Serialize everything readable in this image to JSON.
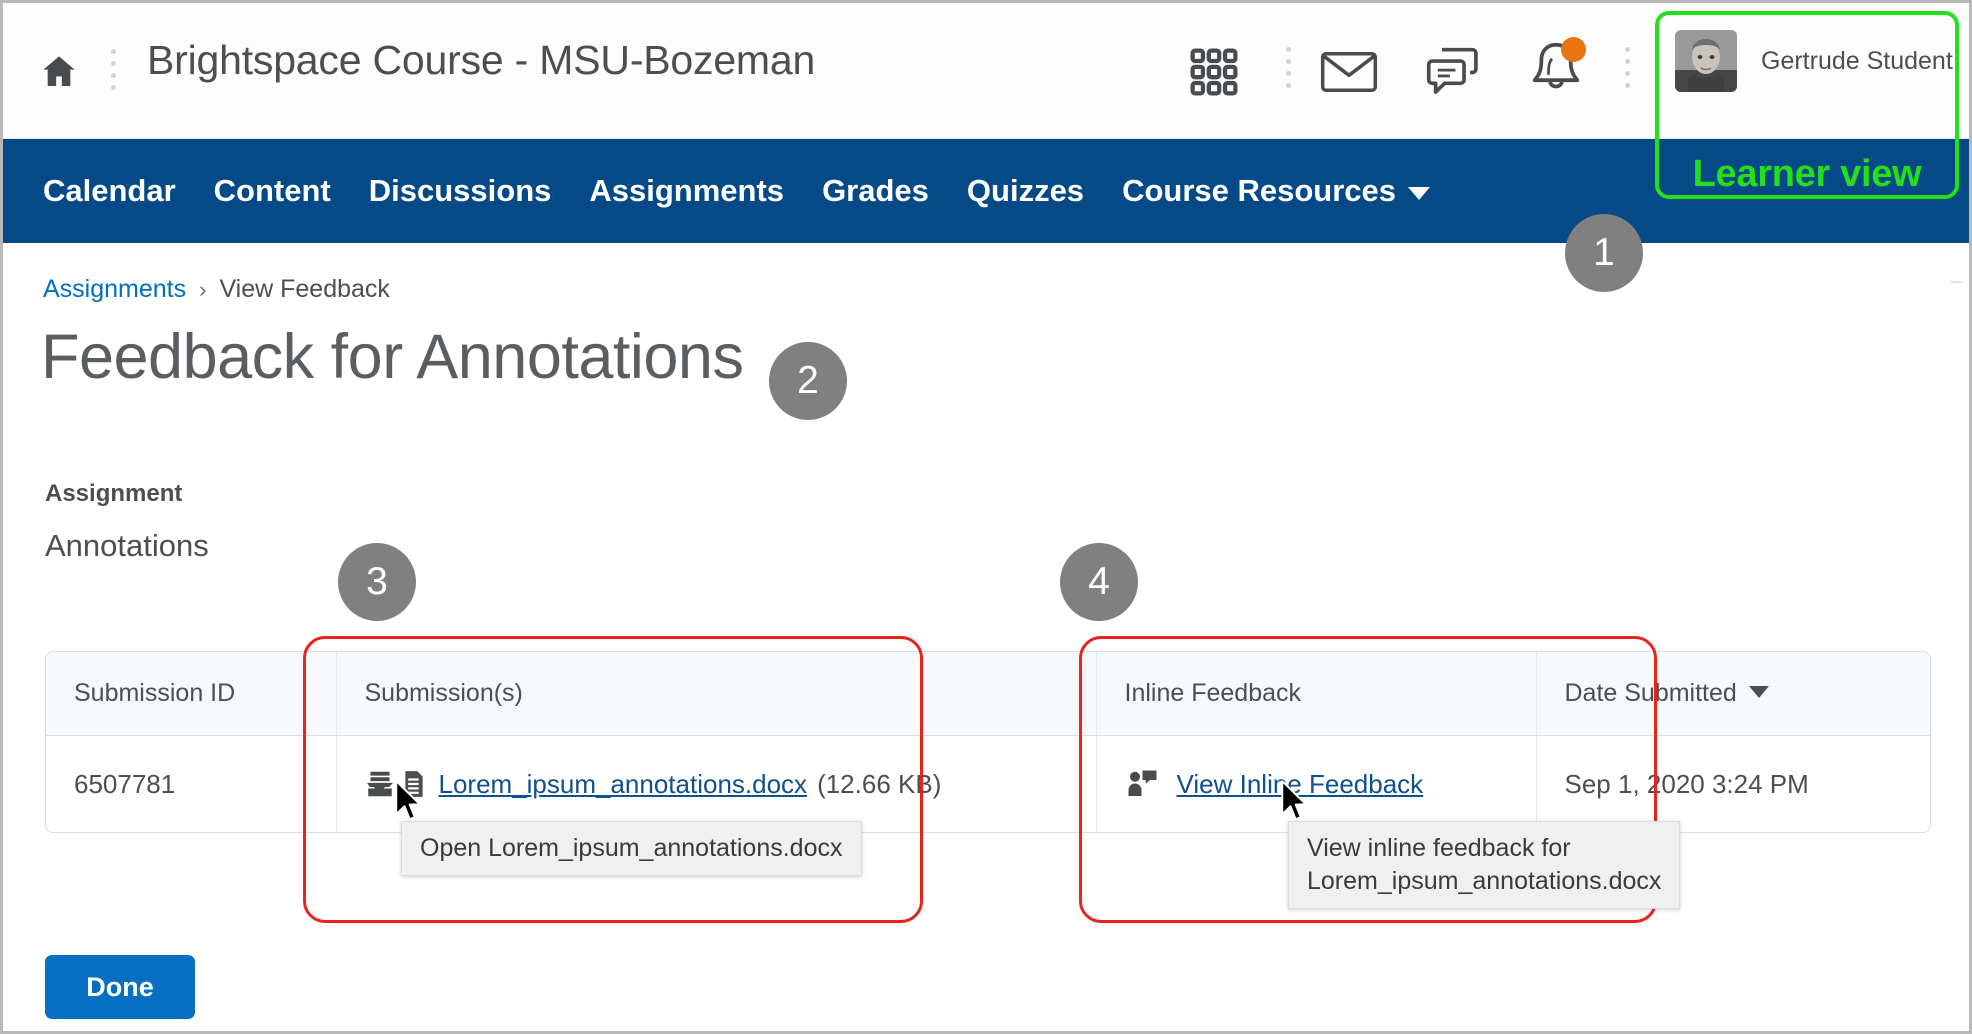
{
  "header": {
    "home_icon": "home-icon",
    "course_title": "Brightspace Course - MSU-Bozeman",
    "icons": [
      {
        "name": "waffle-menu-icon",
        "label": "Course selector"
      },
      {
        "name": "mail-icon",
        "label": "Email"
      },
      {
        "name": "chat-icon",
        "label": "Subscription alerts"
      },
      {
        "name": "bell-icon",
        "label": "Update alerts"
      }
    ],
    "notification_dot_color": "#e87511",
    "user_name": "Gertrude Student",
    "avatar_name": "user-avatar"
  },
  "annotations": {
    "green_box_label": "Learner view",
    "green_color": "#23e01b",
    "red_color": "#e8231c",
    "badges": [
      {
        "id": "1",
        "number": "1"
      },
      {
        "id": "2",
        "number": "2"
      },
      {
        "id": "3",
        "number": "3"
      },
      {
        "id": "4",
        "number": "4"
      }
    ]
  },
  "nav": {
    "brand_color": "#054a87",
    "items": [
      {
        "label": "Calendar",
        "has_caret": false
      },
      {
        "label": "Content",
        "has_caret": false
      },
      {
        "label": "Discussions",
        "has_caret": false
      },
      {
        "label": "Assignments",
        "has_caret": false
      },
      {
        "label": "Grades",
        "has_caret": false
      },
      {
        "label": "Quizzes",
        "has_caret": false
      },
      {
        "label": "Course Resources",
        "has_caret": true
      }
    ]
  },
  "breadcrumb": {
    "link_label": "Assignments",
    "separator": "›",
    "current_label": "View Feedback",
    "link_color": "#006fbf"
  },
  "page": {
    "title": "Feedback for Annotations",
    "assignment_label": "Assignment",
    "assignment_name": "Annotations"
  },
  "table": {
    "columns": [
      {
        "key": "submission_id",
        "label": "Submission ID",
        "sortable": false
      },
      {
        "key": "submissions",
        "label": "Submission(s)",
        "sortable": false
      },
      {
        "key": "inline_feedback",
        "label": "Inline Feedback",
        "sortable": false
      },
      {
        "key": "date_submitted",
        "label": "Date Submitted",
        "sortable": true,
        "sort_direction": "desc"
      }
    ],
    "rows": [
      {
        "submission_id": "6507781",
        "file_name": "Lorem_ipsum_annotations.docx",
        "file_size": "(12.66 KB)",
        "inline_feedback_link": "View Inline Feedback",
        "date_submitted": "Sep 1, 2020 3:24 PM"
      }
    ]
  },
  "tooltips": {
    "open_file": "Open Lorem_ipsum_annotations.docx",
    "view_inline": "View inline feedback for\nLorem_ipsum_annotations.docx"
  },
  "footer": {
    "done_label": "Done",
    "done_color": "#066fc1"
  }
}
